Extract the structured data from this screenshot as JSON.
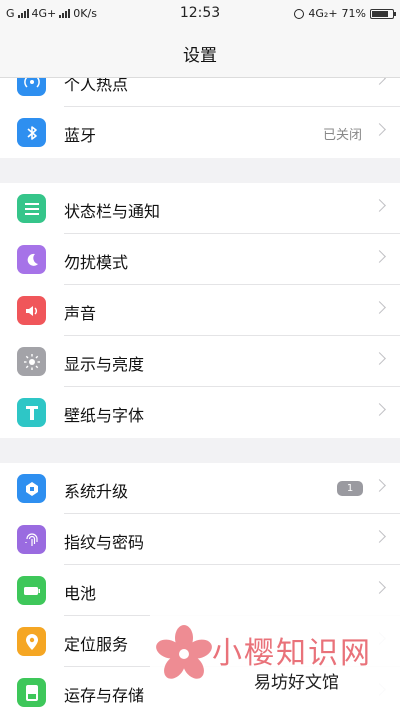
{
  "status": {
    "left": [
      "G",
      "4G+",
      "0K/s"
    ],
    "time": "12:53",
    "network": "4G₂+",
    "battery_text": "71%",
    "battery_level": 0.71
  },
  "navbar": {
    "title": "设置"
  },
  "partial_top": {
    "label": "个人热点"
  },
  "bluetooth": {
    "label": "蓝牙",
    "value": "已关闭"
  },
  "group2": [
    {
      "name": "status-bar-notifications",
      "label": "状态栏与通知",
      "icon": "list-icon",
      "color": "#35c58a"
    },
    {
      "name": "do-not-disturb",
      "label": "勿扰模式",
      "icon": "moon-icon",
      "color": "#a673e8"
    },
    {
      "name": "sound",
      "label": "声音",
      "icon": "speaker-icon",
      "color": "#f0565a"
    },
    {
      "name": "display-brightness",
      "label": "显示与亮度",
      "icon": "sun-icon",
      "color": "#a3a3a8"
    },
    {
      "name": "wallpaper-font",
      "label": "壁纸与字体",
      "icon": "letter-t-icon",
      "color": "#2ec6c6"
    }
  ],
  "group3": [
    {
      "name": "system-update",
      "label": "系统升级",
      "icon": "update-icon",
      "color": "#2e8ff0",
      "badge": "1"
    },
    {
      "name": "fingerprint-password",
      "label": "指纹与密码",
      "icon": "fingerprint-icon",
      "color": "#9a6be0"
    },
    {
      "name": "battery",
      "label": "电池",
      "icon": "battery-icon",
      "color": "#3ec75a"
    },
    {
      "name": "location",
      "label": "定位服务",
      "icon": "location-pin-icon",
      "color": "#f5a623"
    },
    {
      "name": "storage",
      "label": "运存与存储",
      "icon": "storage-icon",
      "color": "#3ec75a"
    }
  ],
  "watermark": {
    "main": "小樱知识网",
    "sub": "易坊好文馆"
  }
}
